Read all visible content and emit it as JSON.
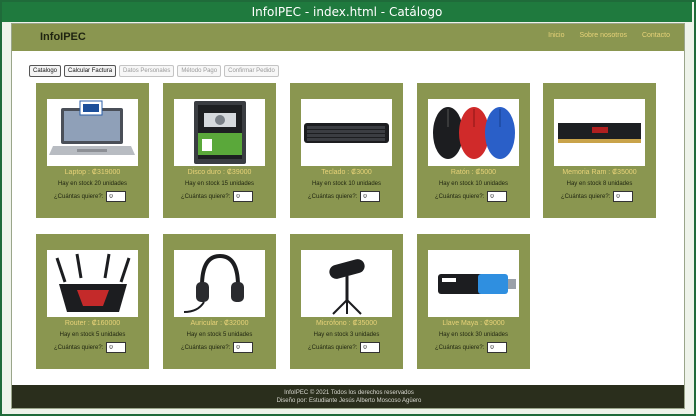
{
  "window": {
    "title": "InfoIPEC - index.html  - Catálogo"
  },
  "nav": {
    "brand": "InfoIPEC",
    "links": [
      "Inicio",
      "Sobre nosotros",
      "Contacto"
    ]
  },
  "steps": [
    {
      "label": "Catalogo",
      "enabled": true
    },
    {
      "label": "Calcular Factura",
      "enabled": true
    },
    {
      "label": "Datos Personales",
      "enabled": false
    },
    {
      "label": "Método Pago",
      "enabled": false
    },
    {
      "label": "Confirmar Pedido",
      "enabled": false
    }
  ],
  "qty_label": "¿Cuántas quiere?:",
  "products": [
    {
      "title": "Laptop : ₡319000",
      "stock": "Hay en stock 20 unidades",
      "qty": "0",
      "icon": "laptop-icon"
    },
    {
      "title": "Disco duro : ₡39000",
      "stock": "Hay en stock 15 unidades",
      "qty": "0",
      "icon": "hard-drive-icon"
    },
    {
      "title": "Teclado : ₡3000",
      "stock": "Hay en stock 10 unidades",
      "qty": "0",
      "icon": "keyboard-icon"
    },
    {
      "title": "Ratón : ₡5000",
      "stock": "Hay en stock 10 unidades",
      "qty": "0",
      "icon": "mouse-icon"
    },
    {
      "title": "Memoria Ram : ₡35000",
      "stock": "Hay en stock 8 unidades",
      "qty": "0",
      "icon": "ram-icon"
    },
    {
      "title": "Router : ₡160000",
      "stock": "Hay en stock 5 unidades",
      "qty": "0",
      "icon": "router-icon"
    },
    {
      "title": "Auricular : ₡32000",
      "stock": "Hay en stock 5 unidades",
      "qty": "0",
      "icon": "headphones-icon"
    },
    {
      "title": "Micrófono : ₡35000",
      "stock": "Hay en stock 3 unidades",
      "qty": "0",
      "icon": "microphone-icon"
    },
    {
      "title": "Llave Maya : ₡9000",
      "stock": "Hay en stock 30 unidades",
      "qty": "0",
      "icon": "usb-drive-icon"
    }
  ],
  "footer": {
    "line1": "InfoIPEC © 2021 Todos los derechos reservados",
    "line2": "Diseño por: Estudiante Jesús Alberto Moscoso Agüero"
  },
  "colors": {
    "accent": "#8a9650",
    "title_text": "#e7d278",
    "footer_bg": "#2a2e1c",
    "window_bar": "#1f7a3e"
  }
}
